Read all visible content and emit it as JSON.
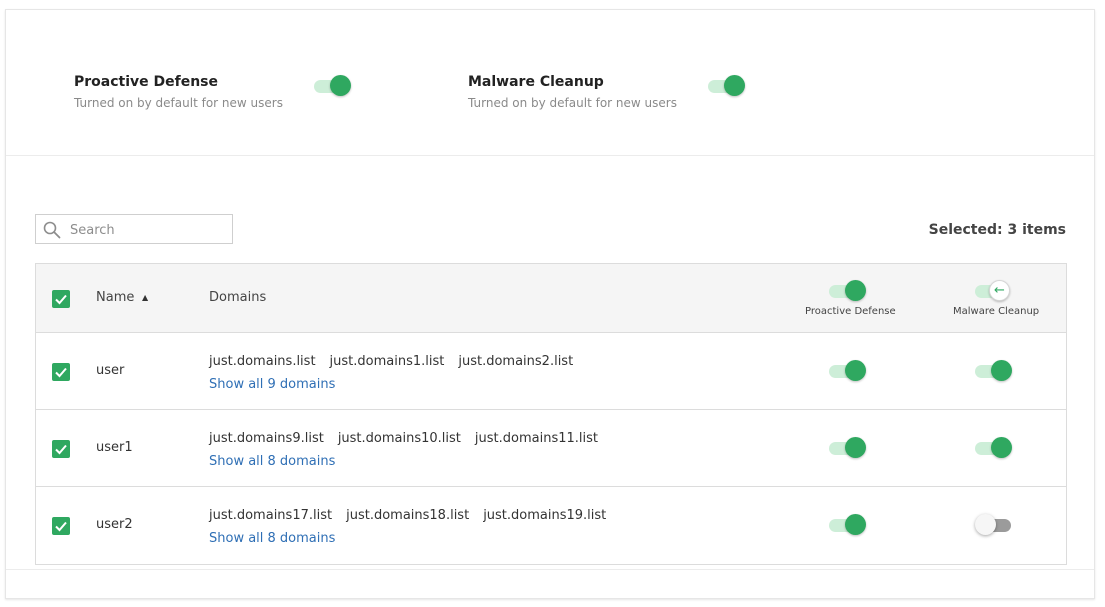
{
  "settings": {
    "proactive_defense": {
      "title": "Proactive Defense",
      "subtitle": "Turned on by default for new users",
      "enabled": true
    },
    "malware_cleanup": {
      "title": "Malware Cleanup",
      "subtitle": "Turned on by default for new users",
      "enabled": true
    }
  },
  "search": {
    "placeholder": "Search",
    "value": ""
  },
  "selected_text": "Selected: 3 items",
  "table": {
    "columns": {
      "name": "Name",
      "domains": "Domains",
      "proactive_defense": "Proactive Defense",
      "malware_cleanup": "Malware Cleanup"
    },
    "sort": {
      "column": "Name",
      "direction": "ascending"
    },
    "rows": [
      {
        "name": "user",
        "domains": [
          "just.domains.list",
          "just.domains1.list",
          "just.domains2.list"
        ],
        "show_all": "Show all 9 domains",
        "proactive_defense": true,
        "malware_cleanup": true,
        "checked": true
      },
      {
        "name": "user1",
        "domains": [
          "just.domains9.list",
          "just.domains10.list",
          "just.domains11.list"
        ],
        "show_all": "Show all 8 domains",
        "proactive_defense": true,
        "malware_cleanup": true,
        "checked": true
      },
      {
        "name": "user2",
        "domains": [
          "just.domains17.list",
          "just.domains18.list",
          "just.domains19.list"
        ],
        "show_all": "Show all 8 domains",
        "proactive_defense": true,
        "malware_cleanup": false,
        "checked": true
      }
    ]
  },
  "colors": {
    "accent": "#2fa860",
    "accent_light": "#cdeed8",
    "link": "#2f6fb5"
  }
}
